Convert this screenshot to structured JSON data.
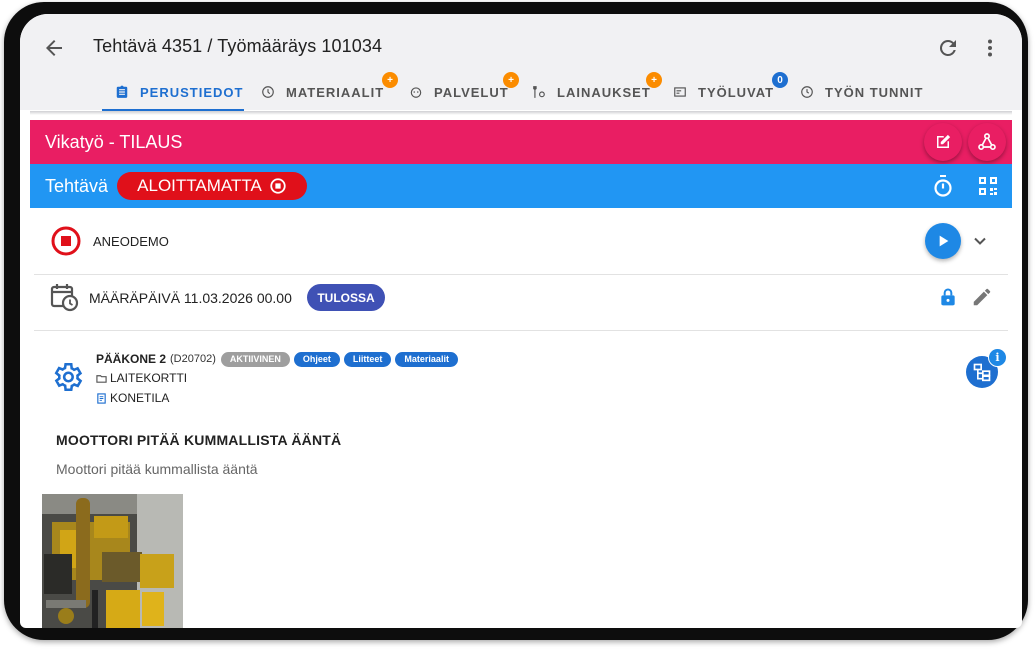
{
  "header": {
    "title": "Tehtävä 4351 / Työmääräys 101034"
  },
  "tabs": [
    {
      "label": "PERUSTIEDOT",
      "badge": "",
      "icon": "clipboard-icon"
    },
    {
      "label": "MATERIAALIT",
      "badge": "+",
      "icon": "cog-icon"
    },
    {
      "label": "PALVELUT",
      "badge": "+",
      "icon": "service-icon"
    },
    {
      "label": "LAINAUKSET",
      "badge": "+",
      "icon": "tools-icon"
    },
    {
      "label": "TYÖLUVAT",
      "badge": "0",
      "icon": "permit-icon"
    },
    {
      "label": "TYÖN TUNNIT",
      "badge": "",
      "icon": "clock-icon"
    }
  ],
  "order": {
    "title": "Vikatyö - TILAUS"
  },
  "task": {
    "label": "Tehtävä",
    "status": "ALOITTAMATTA"
  },
  "worker": {
    "name": "ANEODEMO"
  },
  "deadline": {
    "text": "MÄÄRÄPÄIVÄ 11.03.2026 00.00",
    "status": "TULOSSA"
  },
  "machine": {
    "name": "PÄÄKONE 2",
    "code": "(D20702)",
    "chips": [
      {
        "label": "AKTIIVINEN",
        "color": "#9e9e9e"
      },
      {
        "label": "Ohjeet",
        "color": "#1e6fd0"
      },
      {
        "label": "Liitteet",
        "color": "#1e6fd0"
      },
      {
        "label": "Materiaalit",
        "color": "#1e6fd0"
      }
    ],
    "links": [
      "LAITEKORTTI",
      "KONETILA"
    ]
  },
  "fault": {
    "title": "MOOTTORI PITÄÄ KUMMALLISTA ÄÄNTÄ",
    "description": "Moottori pitää kummallista ääntä"
  },
  "colors": {
    "pink": "#e91e63",
    "blue": "#2196f3",
    "status_red": "#e0101a",
    "indigo": "#3f51b5",
    "orange_badge": "#fb8c00",
    "tab_active": "#1e6fd0"
  }
}
